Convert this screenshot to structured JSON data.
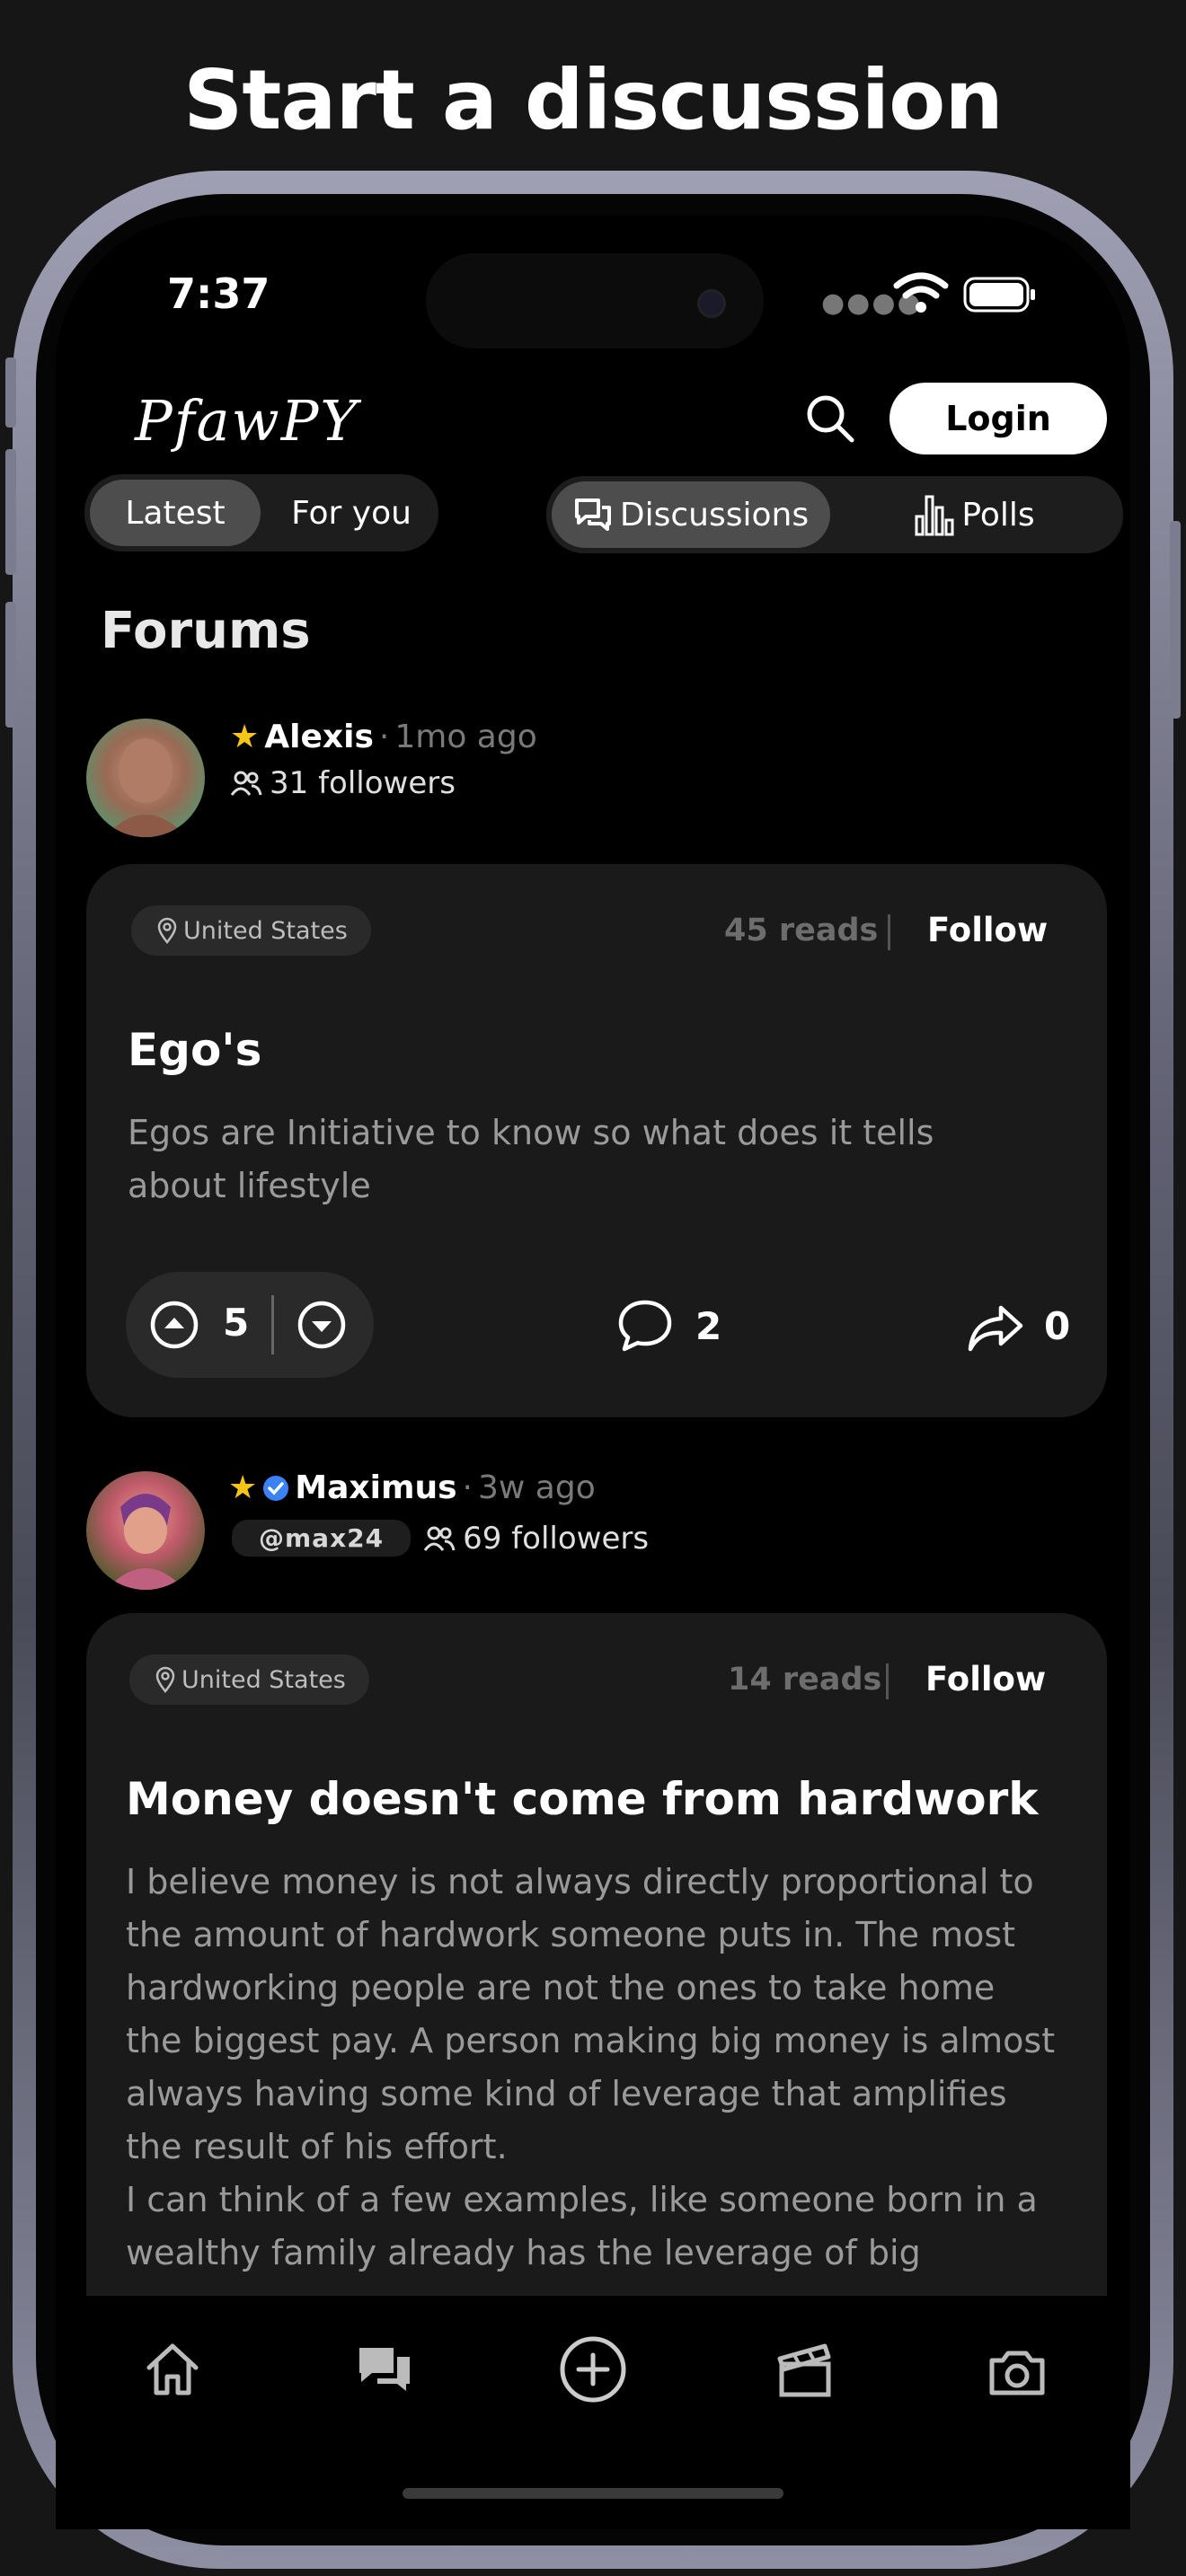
{
  "headline": "Start a discussion",
  "status_bar": {
    "time": "7:37"
  },
  "header": {
    "logo_text": "PfawPY",
    "login_label": "Login"
  },
  "feed_tabs": {
    "latest": "Latest",
    "for_you": "For you",
    "active": "Latest"
  },
  "type_tabs": {
    "discussions": "Discussions",
    "polls": "Polls",
    "active": "Discussions"
  },
  "section_title": "Forums",
  "posts": [
    {
      "author": "Alexis",
      "time": "1mo ago",
      "followers": "31 followers",
      "location": "United States",
      "reads": "45 reads",
      "follow_label": "Follow",
      "title": "Ego's",
      "body": "Egos are Initiative to know so what does it tells about lifestyle",
      "upvotes": "5",
      "comments": "2",
      "shares": "0"
    },
    {
      "author": "Maximus",
      "time": "3w ago",
      "handle": "@max24",
      "followers": "69 followers",
      "location": "United States",
      "reads": "14 reads",
      "follow_label": "Follow",
      "title": "Money doesn't come from hardwork",
      "body": "I believe money is not always directly proportional to the amount of hardwork someone puts in. The most hardworking people are not the ones to take home the biggest pay. A person making big money is almost always having some kind of leverage that amplifies the result of his effort.\nI can think of a few examples, like someone born in a wealthy family already has the leverage of big"
    }
  ],
  "bottom_nav": [
    "home-icon",
    "discussions-icon",
    "create-icon",
    "clapperboard-icon",
    "camera-icon"
  ],
  "colors": {
    "background": "#000000",
    "card": "#1a1a1a",
    "star": "#f5c518",
    "verified": "#3b82f6"
  }
}
